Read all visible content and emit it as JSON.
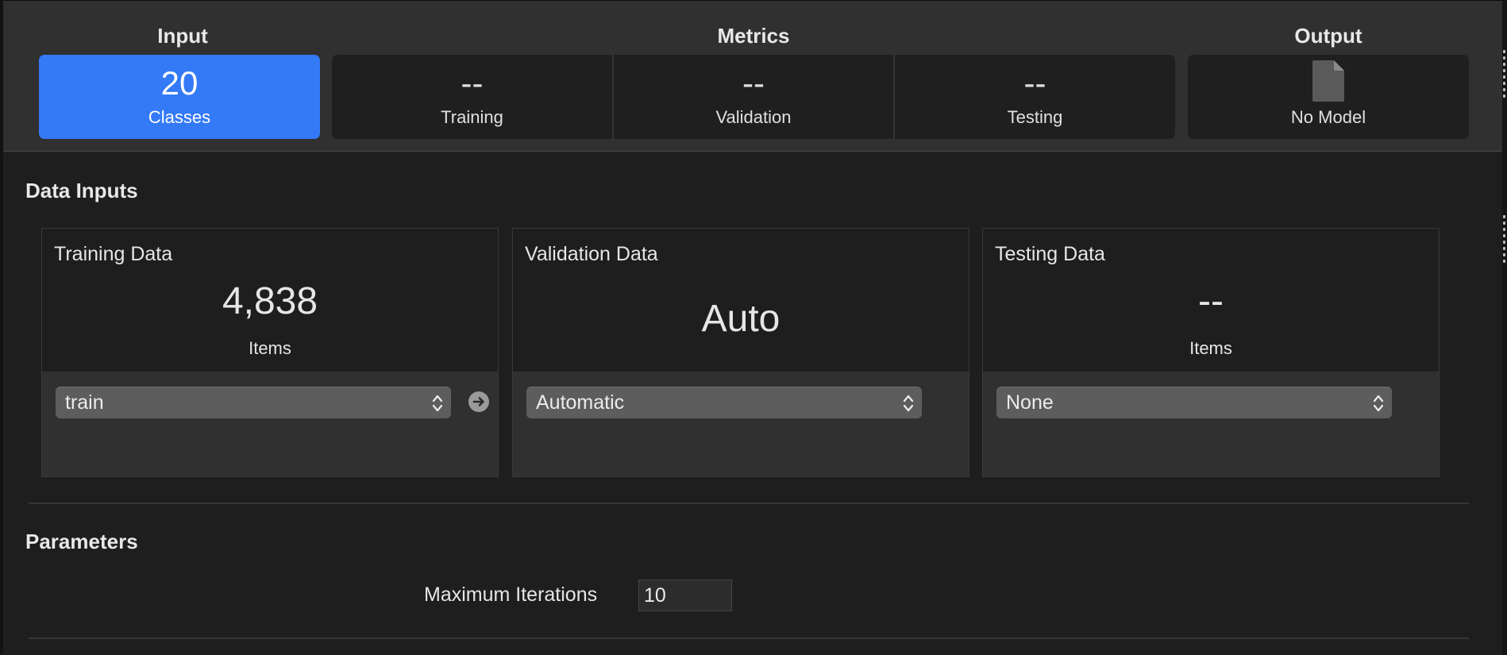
{
  "summary": {
    "input_label": "Input",
    "metrics_label": "Metrics",
    "output_label": "Output",
    "classes": {
      "value": "20",
      "label": "Classes"
    },
    "training": {
      "value": "--",
      "label": "Training"
    },
    "validation": {
      "value": "--",
      "label": "Validation"
    },
    "testing": {
      "value": "--",
      "label": "Testing"
    },
    "model": {
      "icon": "document-icon",
      "label": "No Model"
    },
    "accent": "#3479f6"
  },
  "data_inputs": {
    "title": "Data Inputs",
    "training": {
      "title": "Training Data",
      "value": "4,838",
      "unit": "Items",
      "source": "train"
    },
    "validation": {
      "title": "Validation Data",
      "value": "Auto",
      "source": "Automatic"
    },
    "testing": {
      "title": "Testing Data",
      "value": "--",
      "unit": "Items",
      "source": "None"
    }
  },
  "parameters": {
    "title": "Parameters",
    "max_iterations_label": "Maximum Iterations",
    "max_iterations_value": "10"
  }
}
